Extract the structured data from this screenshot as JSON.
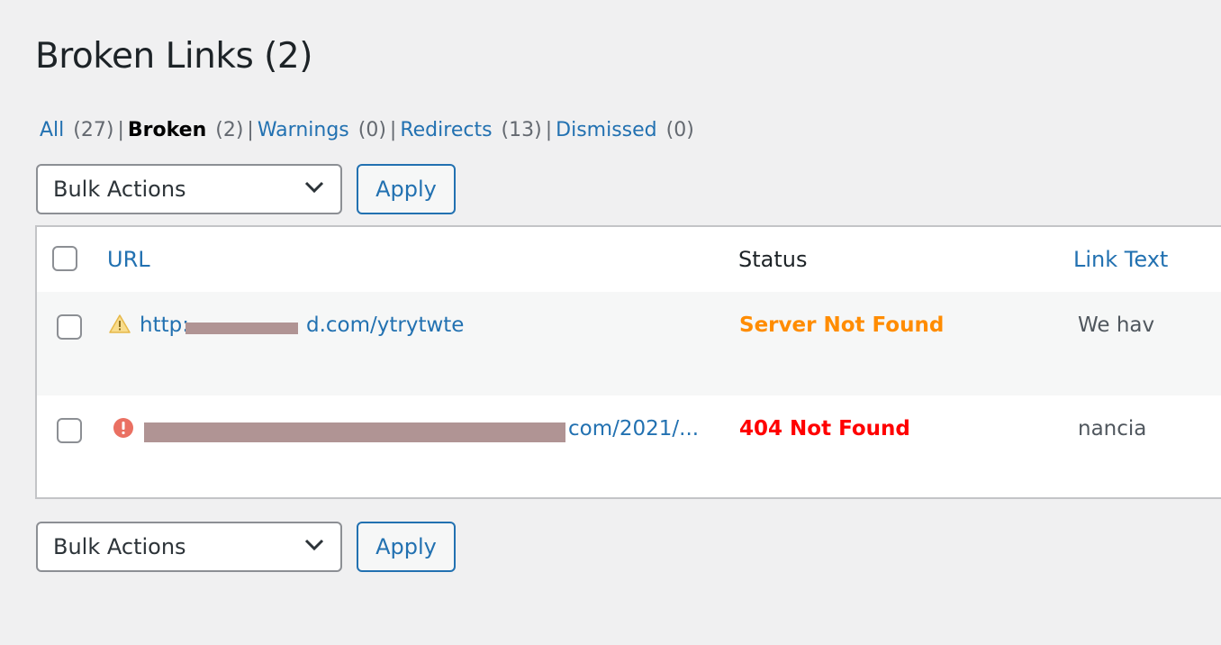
{
  "page": {
    "title": "Broken Links (2)"
  },
  "filters": [
    {
      "label": "All",
      "count": "(27)",
      "current": false
    },
    {
      "label": "Broken",
      "count": "(2)",
      "current": true
    },
    {
      "label": "Warnings",
      "count": "(0)",
      "current": false
    },
    {
      "label": "Redirects",
      "count": "(13)",
      "current": false
    },
    {
      "label": "Dismissed",
      "count": "(0)",
      "current": false
    }
  ],
  "bulk_top": {
    "select_value": "Bulk Actions",
    "apply_label": "Apply"
  },
  "bulk_bottom": {
    "select_value": "Bulk Actions",
    "apply_label": "Apply"
  },
  "table": {
    "headers": {
      "url": "URL",
      "status": "Status",
      "link_text": "Link Text"
    },
    "rows": [
      {
        "icon": "warning-icon",
        "url_prefix": "http:",
        "url_suffix": "d.com/ytrytwte",
        "status": "Server Not Found",
        "status_color": "#ff8c00",
        "link_text": "We hav"
      },
      {
        "icon": "error-icon",
        "url_prefix": "",
        "url_suffix": "com/2021/...",
        "status": "404 Not Found",
        "status_color": "#ff0000",
        "link_text": "nancia"
      }
    ]
  },
  "colors": {
    "link": "#2271b1",
    "warning": "#ff8c00",
    "error": "#ff0000"
  }
}
